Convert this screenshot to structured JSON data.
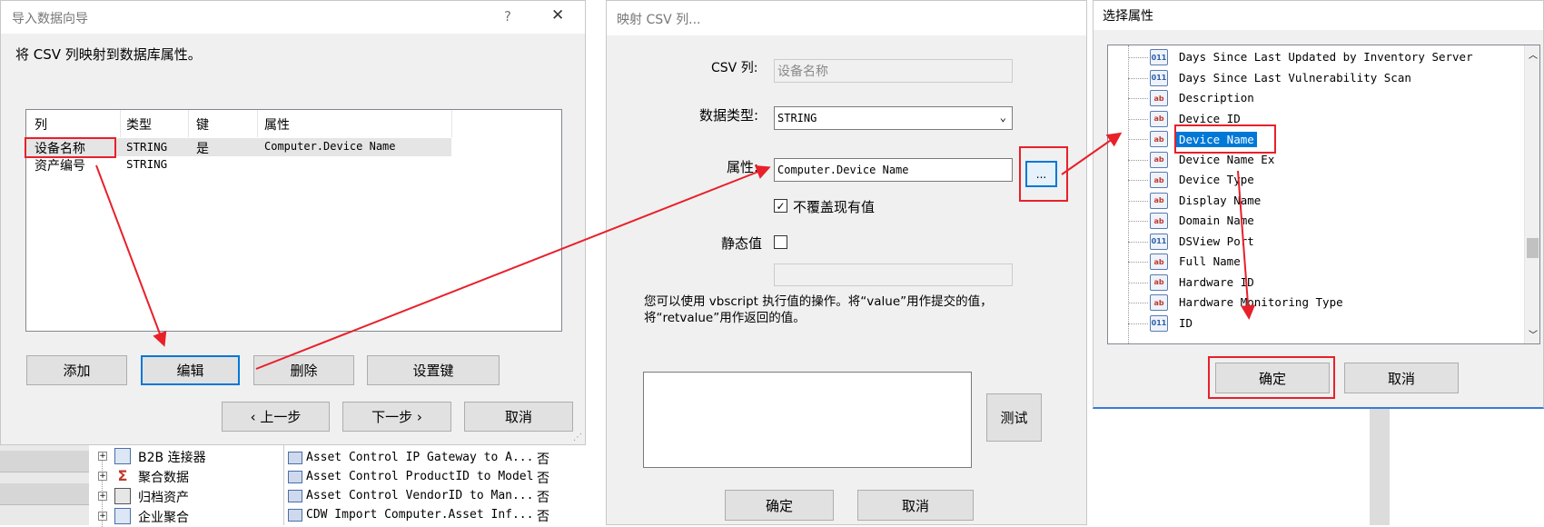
{
  "wizard": {
    "title": "导入数据向导",
    "help": "?",
    "close": "✕",
    "instruction": "将 CSV 列映射到数据库属性。",
    "columns": [
      "列",
      "类型",
      "键",
      "属性"
    ],
    "rows": [
      {
        "col": "设备名称",
        "type": "STRING",
        "key": "是",
        "attr": "Computer.Device Name"
      },
      {
        "col": "资产编号",
        "type": "STRING",
        "key": "",
        "attr": ""
      }
    ],
    "add": "添加",
    "edit": "编辑",
    "delete": "删除",
    "set_key": "设置键",
    "prev": "‹ 上一步",
    "next": "下一步 ›",
    "cancel": "取消"
  },
  "background": {
    "tree_items": [
      "B2B 连接器",
      "聚合数据",
      "归档资产",
      "企业聚合"
    ],
    "list_items": [
      {
        "name": "Asset Control IP Gateway to A...",
        "flag": "否"
      },
      {
        "name": "Asset Control ProductID to Model",
        "flag": "否"
      },
      {
        "name": "Asset Control VendorID to Man...",
        "flag": "否"
      },
      {
        "name": "CDW Import Computer.Asset Inf...",
        "flag": "否"
      }
    ]
  },
  "mapping": {
    "title": "映射 CSV 列...",
    "csv_label": "CSV 列:",
    "csv_value": "设备名称",
    "type_label": "数据类型:",
    "type_value": "STRING",
    "attr_label": "属性:",
    "attr_value": "Computer.Device Name",
    "browse": "...",
    "no_overwrite": "不覆盖现有值",
    "static_label": "静态值",
    "hint": "您可以使用 vbscript 执行值的操作。将“value”用作提交的值，将“retvalue”用作返回的值。",
    "test": "测试",
    "ok": "确定",
    "cancel": "取消"
  },
  "select": {
    "title": "选择属性",
    "items": [
      {
        "label": "Days Since Last Updated by Inventory Server",
        "icon": "011"
      },
      {
        "label": "Days Since Last Vulnerability Scan",
        "icon": "011"
      },
      {
        "label": "Description",
        "icon": "ab"
      },
      {
        "label": "Device ID",
        "icon": "ab"
      },
      {
        "label": "Device Name",
        "icon": "ab"
      },
      {
        "label": "Device Name Ex",
        "icon": "ab"
      },
      {
        "label": "Device Type",
        "icon": "ab"
      },
      {
        "label": "Display Name",
        "icon": "ab"
      },
      {
        "label": "Domain Name",
        "icon": "ab"
      },
      {
        "label": "DSView Port",
        "icon": "011"
      },
      {
        "label": "Full Name",
        "icon": "ab"
      },
      {
        "label": "Hardware ID",
        "icon": "ab"
      },
      {
        "label": "Hardware Monitoring Type",
        "icon": "ab"
      },
      {
        "label": "ID",
        "icon": "011"
      }
    ],
    "ok": "确定",
    "cancel": "取消"
  },
  "colors": {
    "annotation_red": "#e8202a",
    "selection_blue": "#0078d7"
  }
}
